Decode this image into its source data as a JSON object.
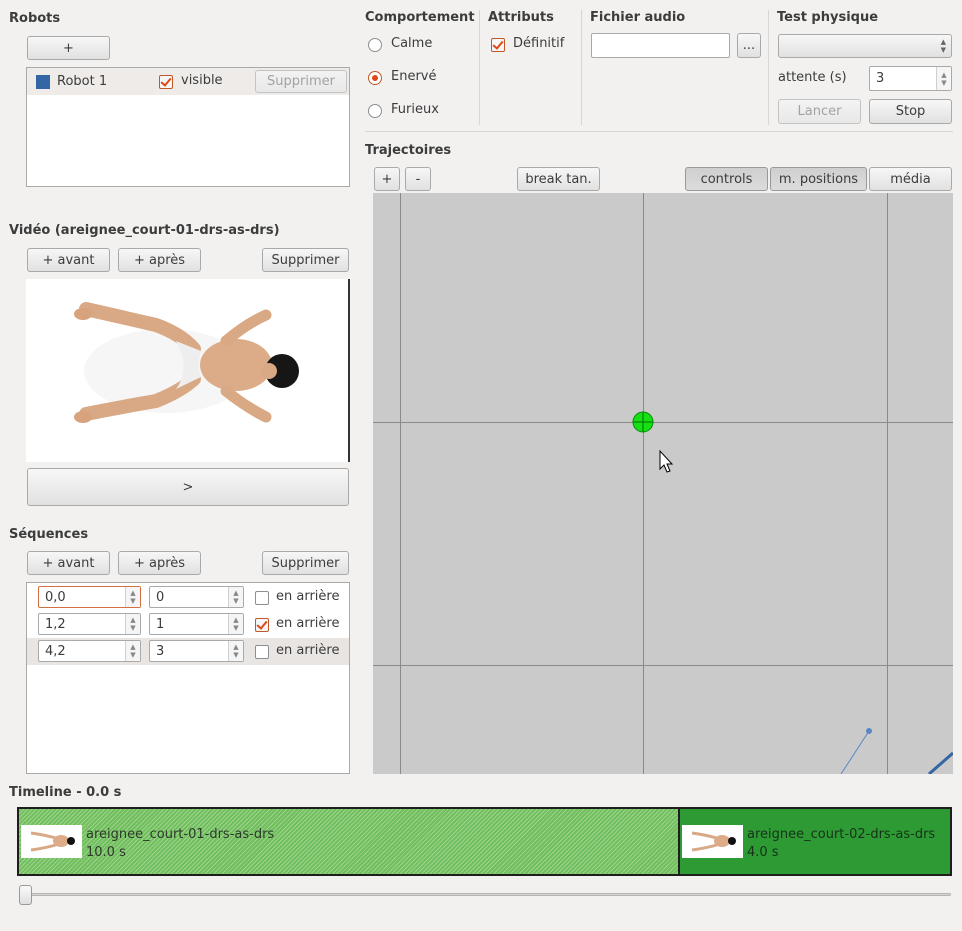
{
  "robots": {
    "title": "Robots",
    "add_label": "+",
    "items": [
      {
        "name": "Robot 1",
        "color": "#3465a4",
        "visible_label": "visible",
        "visible": true,
        "delete_label": "Supprimer"
      }
    ]
  },
  "video": {
    "title": "Vidéo (areignee_court-01-drs-as-drs)",
    "before_label": "+ avant",
    "after_label": "+ après",
    "delete_label": "Supprimer",
    "play_label": ">"
  },
  "sequences": {
    "title": "Séquences",
    "before_label": "+ avant",
    "after_label": "+ après",
    "delete_label": "Supprimer",
    "rows": [
      {
        "start": "0,0",
        "index": "0",
        "reverse_label": "en arrière",
        "reverse": false
      },
      {
        "start": "1,2",
        "index": "1",
        "reverse_label": "en arrière",
        "reverse": true
      },
      {
        "start": "4,2",
        "index": "3",
        "reverse_label": "en arrière",
        "reverse": false
      }
    ]
  },
  "behavior": {
    "title": "Comportement",
    "options": [
      {
        "label": "Calme",
        "selected": false
      },
      {
        "label": "Enervé",
        "selected": true
      },
      {
        "label": "Furieux",
        "selected": false
      }
    ]
  },
  "attributes": {
    "title": "Attributs",
    "definitive_label": "Définitif",
    "definitive": true
  },
  "audio": {
    "title": "Fichier audio",
    "value": "",
    "browse_label": "..."
  },
  "physics": {
    "title": "Test physique",
    "select_value": "",
    "wait_label": "attente (s)",
    "wait_value": "3",
    "launch_label": "Lancer",
    "stop_label": "Stop"
  },
  "trajectories": {
    "title": "Trajectoires",
    "add_label": "+",
    "remove_label": "-",
    "break_label": "break tan.",
    "controls_label": "controls",
    "positions_label": "m. positions",
    "media_label": "média"
  },
  "timeline": {
    "title": "Timeline - 0.0 s",
    "clips": [
      {
        "name": "areignee_court-01-drs-as-drs",
        "duration": "10.0 s"
      },
      {
        "name": "areignee_court-02-drs-as-drs",
        "duration": "4.0 s"
      }
    ],
    "position": 0
  },
  "colors": {
    "accent": "#dd4814",
    "clip_green": "#2e9a33",
    "canvas_bg": "#cacaca",
    "marker_green": "#14e014",
    "path_blue": "#3465a4"
  }
}
